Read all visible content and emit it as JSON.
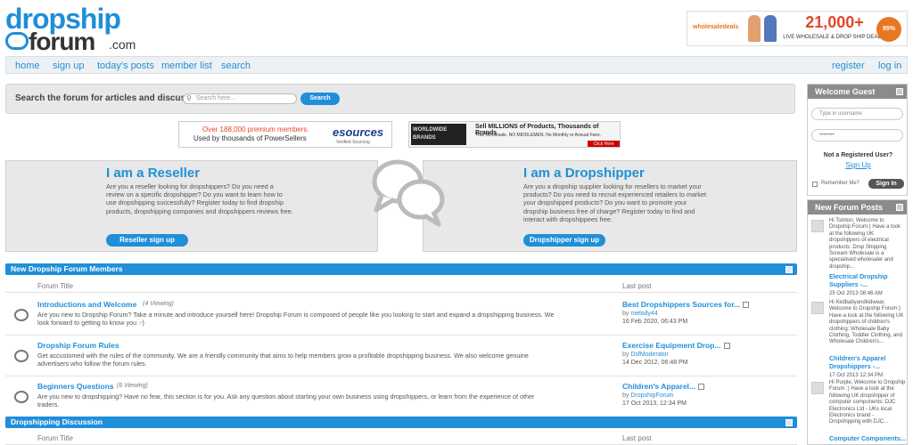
{
  "logo": {
    "line1": "dropship",
    "line2": "forum",
    "suffix": ".com"
  },
  "top_ad": {
    "brand": "wholesaledeals",
    "count": "21,000+",
    "tagline": "LIVE WHOLESALE & DROP SHIP DEALS",
    "badge": "95%"
  },
  "nav": {
    "home": "home",
    "signup": "sign up",
    "todays_posts": "today's posts",
    "member_list": "member list",
    "search": "search",
    "register": "register",
    "login": "log in"
  },
  "search": {
    "label": "Search the forum for articles and discussions",
    "placeholder": "Search here...",
    "button": "Search"
  },
  "ad1": {
    "line1": "Over 188,000 premium members.",
    "line2": "Used by thousands of PowerSellers",
    "logo": "esources",
    "logo_sub": "Verified Sourcing"
  },
  "ad2": {
    "brand": "WORLDWIDE BRANDS",
    "headline": "Sell MILLIONS of Products, Thousands of Brands",
    "sub": "True Wholesale. NO MIDDLEMEN. No Monthly or Annual Fees.",
    "click": "Click Here"
  },
  "reseller": {
    "title": "I am a Reseller",
    "text": "Are you a reseller looking for dropshippers? Do you need a review on a specific dropshipper? Do you want to learn how to use dropshipping successfully? Register today to find dropship products, dropshipping companies and dropshippers reviews free.",
    "button": "Reseller sign up"
  },
  "dropshipper": {
    "title": "I am a Dropshipper",
    "text": "Are you a dropship supplier looking for resellers to market your products? Do you need to recruit experienced retailers to market your dropshipped products? Do you want to promote your dropship business free of charge? Register today to find and interact with dropshippees free.",
    "button": "Dropshipper sign up"
  },
  "section1": {
    "title": "New Dropship Forum Members",
    "col_title": "Forum Title",
    "col_last": "Last post"
  },
  "forums": [
    {
      "title": "Introductions and Welcome",
      "viewing": "(4 Viewing)",
      "desc": "Are you new to Dropship Forum? Take a minute and introduce yourself here! Dropship Forum is composed of people like you looking to start and expand a dropshipping business. We look forward to getting to know you :-)",
      "last_title": "Best Dropshippers Sources for...",
      "by": "by",
      "last_user": "melody44",
      "last_date": "16 Feb 2020, 06:43 PM"
    },
    {
      "title": "Dropship Forum Rules",
      "viewing": "",
      "desc": "Get accustomed with the rules of the community. We are a friendly community that aims to help members grow a profitable dropshipping business. We also welcome genuine advertisers who follow the forum rules.",
      "last_title": "Exercise Equipment Drop...",
      "by": "by",
      "last_user": "DsfModerator",
      "last_date": "14 Dec 2012, 06:48 PM"
    },
    {
      "title": "Beginners Questions",
      "viewing": "(6 Viewing)",
      "desc": "Are you new to dropshipping? Have no fear, this section is for you. Ask any question about starting your own business using dropshippers, or learn from the experience of other traders.",
      "last_title": "Children's Apparel...",
      "by": "by",
      "last_user": "DropshipForum",
      "last_date": "17 Oct 2013, 12:34 PM"
    }
  ],
  "section2": {
    "title": "Dropshipping Discussion",
    "col_title": "Forum Title",
    "col_last": "Last post"
  },
  "sidebar": {
    "welcome": "Welcome Guest",
    "username_placeholder": "Type in username",
    "password_value": "••••••••",
    "not_registered": "Not a Registered User?",
    "signup": "Sign Up",
    "remember": "Remember Me?",
    "signin": "Sign In",
    "posts_title": "New Forum Posts",
    "posts": [
      {
        "text": "Hi Tointon, Welcome to Dropship Forum:) Have a look at the following UK dropshippers of electrical products: Drop Shipping Scream Wholesale is a specialised wholesaler and dropship...",
        "link": "Electrical Dropship Suppliers -...",
        "date": "25 Oct 2013 08:46 AM"
      },
      {
        "text": "Hi Kkdbabyandkidwear, Welcome to Dropship Forum:) Have a look at the following UK dropshippers of children's clothing: Wholesale Baby Clothing, Toddler Clothing, and Wholesale Children's...",
        "link": "Children's Apparel Dropshippers -...",
        "date": "17 Oct 2013 12:34 PM"
      },
      {
        "text": "Hi Purple, Welcome to Dropship Forum :) Have a look at the following UK dropshipper of computer components: DJC Electronics Ltd - UKs local Electronics brand - Dropshipping with DJC...",
        "link": "Computer Components...",
        "date": ""
      }
    ]
  }
}
